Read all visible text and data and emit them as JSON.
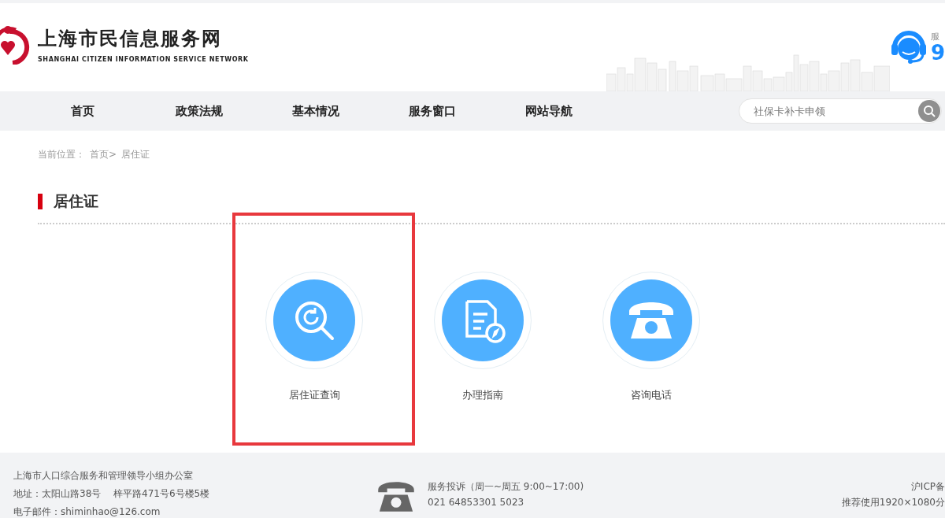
{
  "site": {
    "title": "上海市民信息服务网",
    "subtitle": "SHANGHAI CITIZEN INFORMATION SERVICE NETWORK",
    "hotline_label": "服",
    "hotline_number": "9"
  },
  "nav": [
    {
      "label": "首页"
    },
    {
      "label": "政策法规"
    },
    {
      "label": "基本情况"
    },
    {
      "label": "服务窗口"
    },
    {
      "label": "网站导航"
    }
  ],
  "search": {
    "placeholder": "社保卡补卡申领"
  },
  "breadcrumb": {
    "prefix": "当前位置：",
    "links": [
      "首页>",
      "居住证"
    ]
  },
  "section": {
    "title": "居住证"
  },
  "items": [
    {
      "kind": "query",
      "label": "居住证查询",
      "selected": true
    },
    {
      "kind": "guide",
      "label": "办理指南",
      "selected": false
    },
    {
      "kind": "phone",
      "label": "咨询电话",
      "selected": false
    }
  ],
  "footer": {
    "office": [
      "上海市人口综合服务和管理领导小组办公室",
      "地址：太阳山路38号　 梓平路471号6号楼5楼",
      "电子邮件：shiminhao@126.com"
    ],
    "complaint": "服务投诉（周一~周五 9:00~17:00)",
    "phone": "021 64853301 5023",
    "right": [
      "沪ICP备",
      "推荐使用1920×1080分"
    ]
  }
}
